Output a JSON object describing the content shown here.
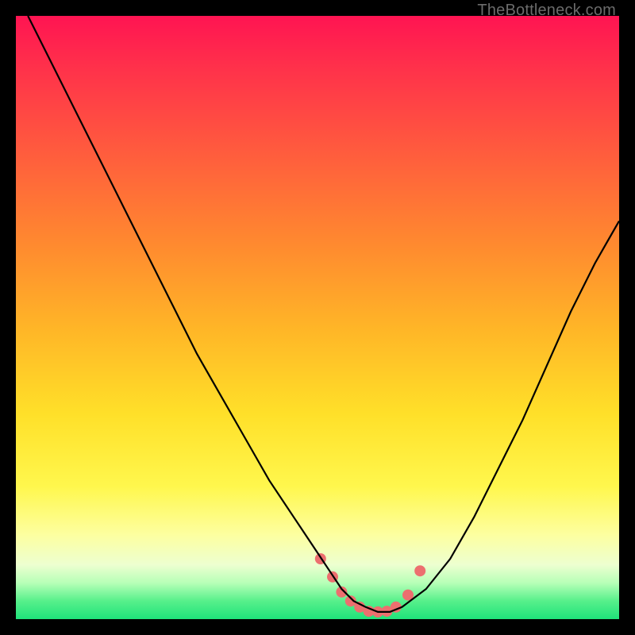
{
  "watermark": "TheBottleneck.com",
  "chart_data": {
    "type": "line",
    "title": "",
    "xlabel": "",
    "ylabel": "",
    "xlim": [
      0,
      100
    ],
    "ylim": [
      0,
      100
    ],
    "series": [
      {
        "name": "bottleneck-curve",
        "x": [
          2,
          6,
          10,
          14,
          18,
          22,
          26,
          30,
          34,
          38,
          42,
          46,
          50,
          52,
          54,
          56,
          58,
          60,
          62,
          64,
          68,
          72,
          76,
          80,
          84,
          88,
          92,
          96,
          100
        ],
        "y": [
          100,
          92,
          84,
          76,
          68,
          60,
          52,
          44,
          37,
          30,
          23,
          17,
          11,
          8,
          5,
          3,
          2,
          1.2,
          1.2,
          2,
          5,
          10,
          17,
          25,
          33,
          42,
          51,
          59,
          66
        ]
      }
    ],
    "markers": {
      "name": "highlight-dots",
      "x": [
        50.5,
        52.5,
        54,
        55.5,
        57,
        58.5,
        60,
        61.5,
        63,
        65,
        67
      ],
      "y": [
        10,
        7,
        4.5,
        3,
        2,
        1.3,
        1.2,
        1.3,
        2,
        4,
        8
      ],
      "color": "#ec6f6f",
      "radius_px": 7
    },
    "colors": {
      "curve": "#000000",
      "marker": "#ec6f6f",
      "gradient_top": "#ff1452",
      "gradient_bottom": "#1fe27a"
    }
  }
}
